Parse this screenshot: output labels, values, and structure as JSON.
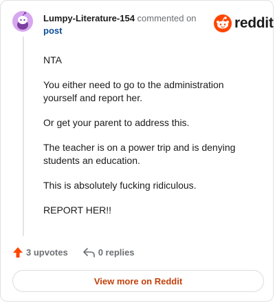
{
  "comment": {
    "username": "Lumpy-Literature-154",
    "action_text": "commented on",
    "post_link": "post",
    "paragraphs": [
      "NTA",
      "You either need to go to the administration yourself and report her.",
      "Or get your parent to address this.",
      "The teacher is on a power trip and is denying students an education.",
      "This is absolutely fucking ridiculous.",
      "REPORT HER!!"
    ]
  },
  "brand": {
    "name": "reddit",
    "icon": "reddit-snoo-icon",
    "color": "#ff4500"
  },
  "actions": {
    "upvotes_label": "3 upvotes",
    "upvote_icon": "upvote-arrow-icon",
    "upvote_color": "#ff4500",
    "replies_label": "0 replies",
    "reply_icon": "reply-arrow-icon"
  },
  "footer": {
    "view_more_label": "View more on Reddit",
    "color": "#c2410c"
  }
}
